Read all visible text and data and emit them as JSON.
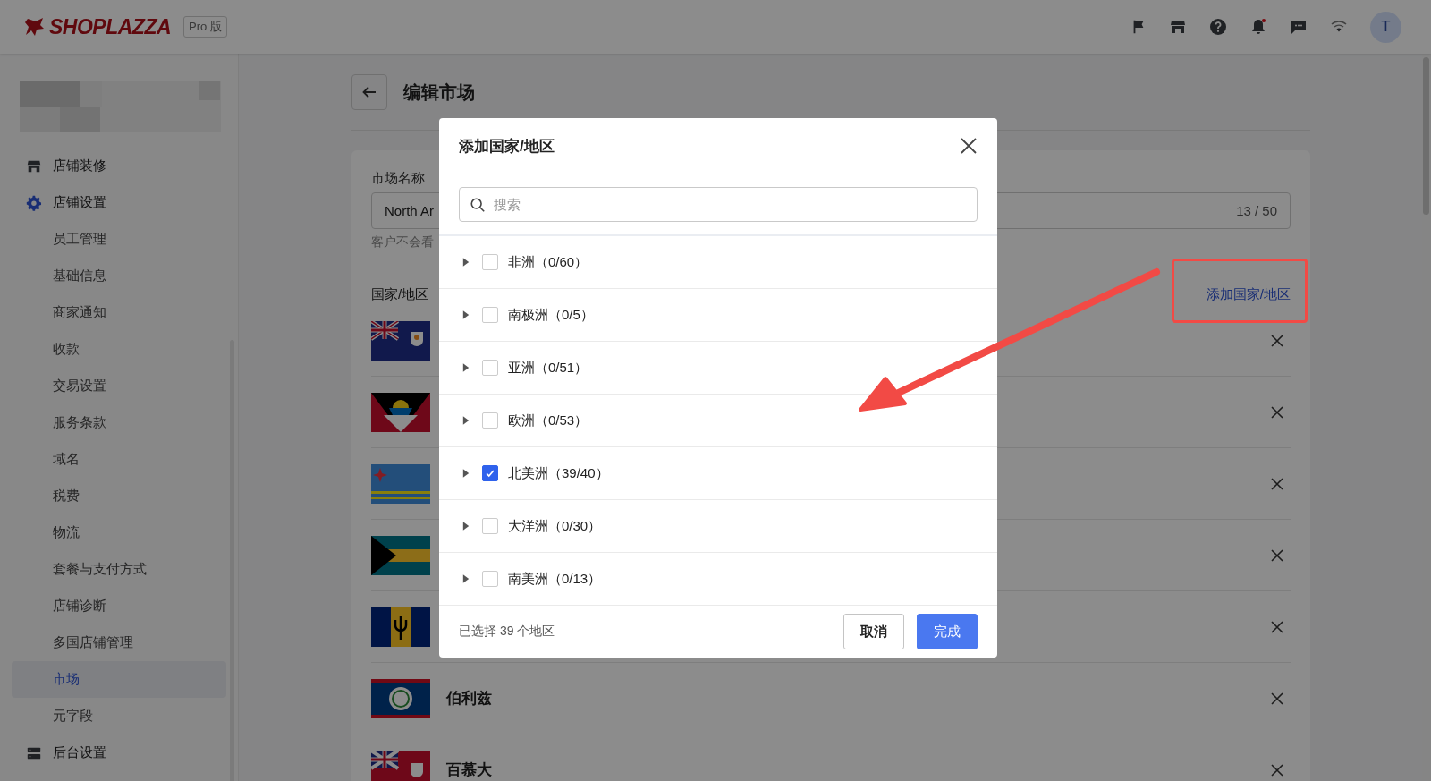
{
  "topbar": {
    "logo": "SHOPLAZZA",
    "edition": "Pro 版",
    "notification_dot": true,
    "avatar": "T"
  },
  "sidebar": {
    "items": [
      {
        "label": "店铺装修",
        "selected": false
      },
      {
        "label": "店铺设置",
        "selected": false,
        "children": [
          {
            "label": "员工管理",
            "selected": false
          },
          {
            "label": "基础信息",
            "selected": false
          },
          {
            "label": "商家通知",
            "selected": false
          },
          {
            "label": "收款",
            "selected": false
          },
          {
            "label": "交易设置",
            "selected": false
          },
          {
            "label": "服务条款",
            "selected": false
          },
          {
            "label": "域名",
            "selected": false
          },
          {
            "label": "税费",
            "selected": false
          },
          {
            "label": "物流",
            "selected": false
          },
          {
            "label": "套餐与支付方式",
            "selected": false
          },
          {
            "label": "店铺诊断",
            "selected": false
          },
          {
            "label": "多国店铺管理",
            "selected": false
          },
          {
            "label": "市场",
            "selected": true
          },
          {
            "label": "元字段",
            "selected": false
          }
        ]
      },
      {
        "label": "后台设置",
        "selected": false
      }
    ]
  },
  "page": {
    "title": "编辑市场",
    "name_field": {
      "label": "市场名称",
      "value": "North Ar",
      "counter": "13 / 50",
      "help": "客户不会看"
    },
    "countries": {
      "label": "国家/地区",
      "add_link": "添加国家/地区",
      "rows": [
        {
          "removable": true
        },
        {
          "removable": true
        },
        {
          "removable": true
        },
        {
          "removable": true
        },
        {
          "removable": true
        },
        {
          "name": "伯利兹",
          "removable": true
        },
        {
          "name": "百慕大",
          "removable": true
        }
      ]
    }
  },
  "modal": {
    "title": "添加国家/地区",
    "search": {
      "placeholder": "搜索"
    },
    "groups": [
      {
        "label": "非洲（0/60）",
        "checked": false,
        "expanded": false
      },
      {
        "label": "南极洲（0/5）",
        "checked": false,
        "expanded": false
      },
      {
        "label": "亚洲（0/51）",
        "checked": false,
        "expanded": false
      },
      {
        "label": "欧洲（0/53）",
        "checked": false,
        "expanded": false
      },
      {
        "label": "北美洲（39/40）",
        "checked": true,
        "expanded": false
      },
      {
        "label": "大洋洲（0/30）",
        "checked": false,
        "expanded": false
      },
      {
        "label": "南美洲（0/13）",
        "checked": false,
        "expanded": false
      }
    ],
    "summary": "已选择 39 个地区",
    "buttons": [
      {
        "label": "取消",
        "kind": "secondary"
      },
      {
        "label": "完成",
        "kind": "primary"
      }
    ]
  },
  "annotations": [
    {
      "kind": "highlight-box"
    },
    {
      "kind": "arrow"
    }
  ]
}
